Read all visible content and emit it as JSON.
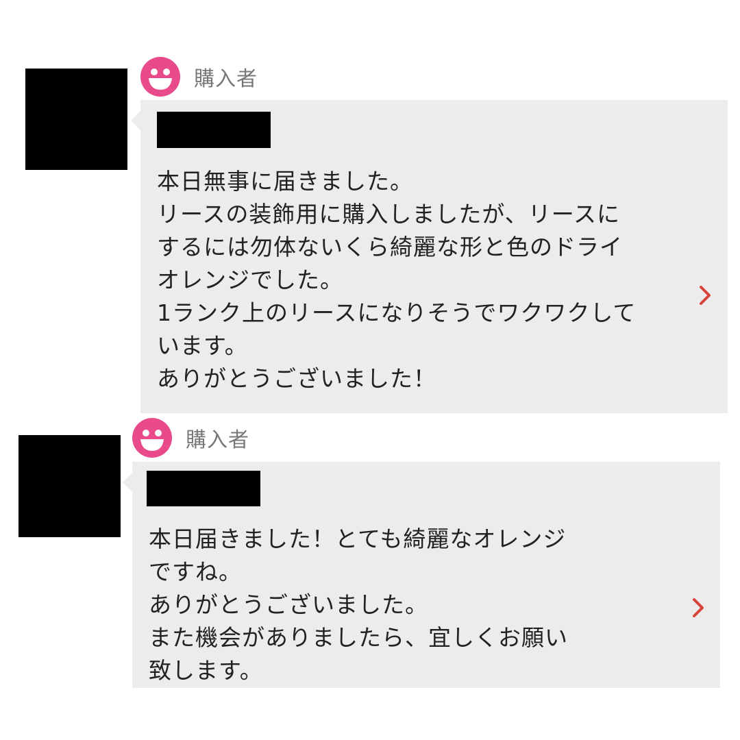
{
  "colors": {
    "bubble_bg": "#ececec",
    "accent_pink": "#e84a8a",
    "chevron_red": "#d9433a",
    "label_gray": "#777777",
    "redaction": "#000000"
  },
  "reviews": [
    {
      "role_label": "購入者",
      "role_icon": "smiley-face-icon",
      "name_redacted": true,
      "avatar_redacted": true,
      "message": "本日無事に届きました。\nリースの装飾用に購入しましたが、リースに\nするには勿体ないくら綺麗な形と色のドライ\nオレンジでした。\n1ランク上のリースになりそうでワクワクして\nいます。\nありがとうございました！",
      "action_icon": "chevron-right-icon"
    },
    {
      "role_label": "購入者",
      "role_icon": "smiley-face-icon",
      "name_redacted": true,
      "avatar_redacted": true,
      "message": "本日届きました！とても綺麗なオレンジ\nですね。\nありがとうございました。\nまた機会がありましたら、宜しくお願い\n致します。",
      "action_icon": "chevron-right-icon"
    }
  ]
}
